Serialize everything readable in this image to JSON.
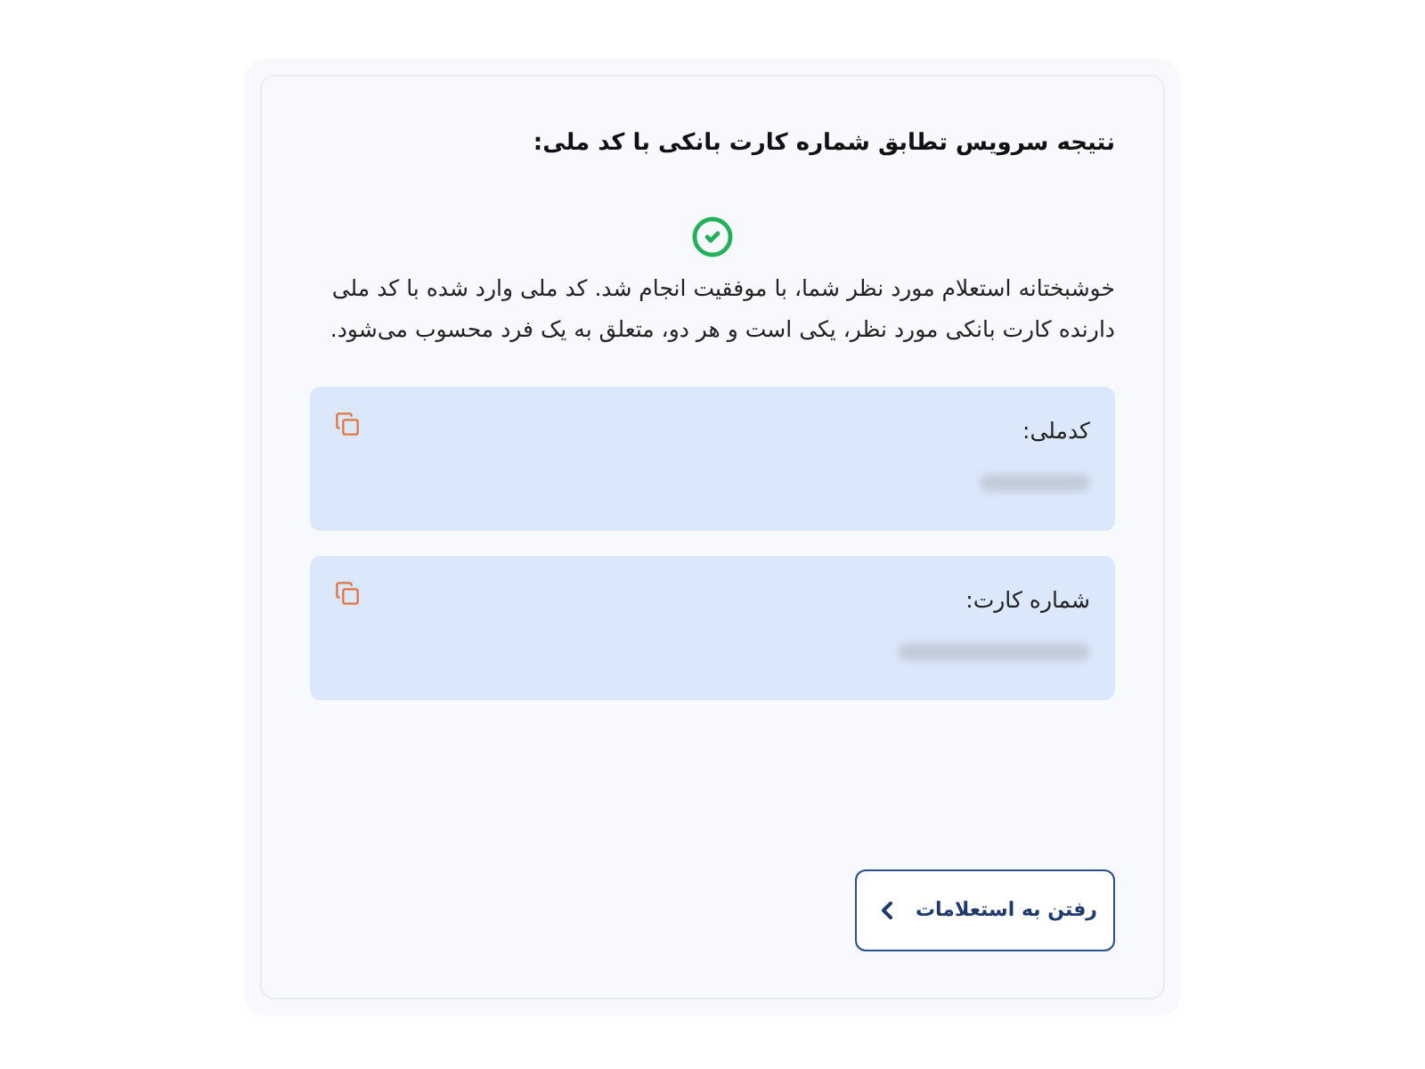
{
  "title": "نتیجه سرویس تطابق شماره کارت بانکی با کد ملی:",
  "message": "خوشبختانه استعلام مورد نظر شما، با موفقیت انجام شد. کد ملی وارد شده با کد ملی دارنده کارت بانکی مورد نظر، یکی است و هر دو، متعلق به یک فرد محسوب می‌شود.",
  "fields": [
    {
      "label": "کدملی:"
    },
    {
      "label": "شماره کارت:"
    }
  ],
  "button": {
    "label": "رفتن به استعلامات"
  }
}
